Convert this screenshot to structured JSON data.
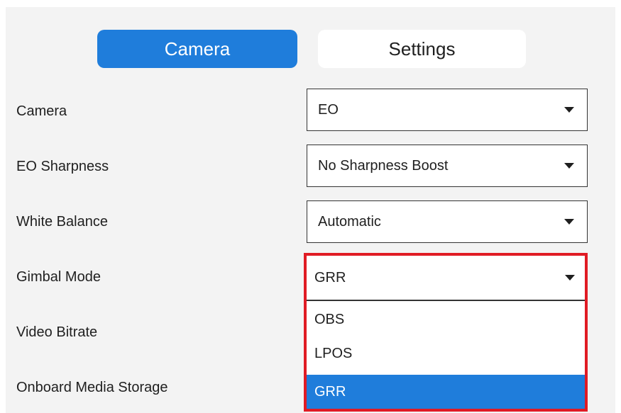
{
  "tabs": {
    "camera_label": "Camera",
    "settings_label": "Settings",
    "active": "Camera"
  },
  "rows": [
    {
      "label": "Camera",
      "value": "EO"
    },
    {
      "label": "EO Sharpness",
      "value": "No Sharpness Boost"
    },
    {
      "label": "White Balance",
      "value": "Automatic"
    },
    {
      "label": "Gimbal Mode",
      "value": "GRR"
    },
    {
      "label": "Video Bitrate",
      "value": ""
    },
    {
      "label": "Onboard Media Storage",
      "value": ""
    }
  ],
  "gimbal_dropdown": {
    "open": true,
    "selected": "GRR",
    "options": [
      "OBS",
      "LPOS",
      "GRR"
    ]
  },
  "colors": {
    "accent": "#1f7ddb",
    "highlight_border": "#e01b24",
    "panel_bg": "#f3f3f3"
  },
  "icons": {
    "dropdown_caret": "caret-down-icon"
  }
}
